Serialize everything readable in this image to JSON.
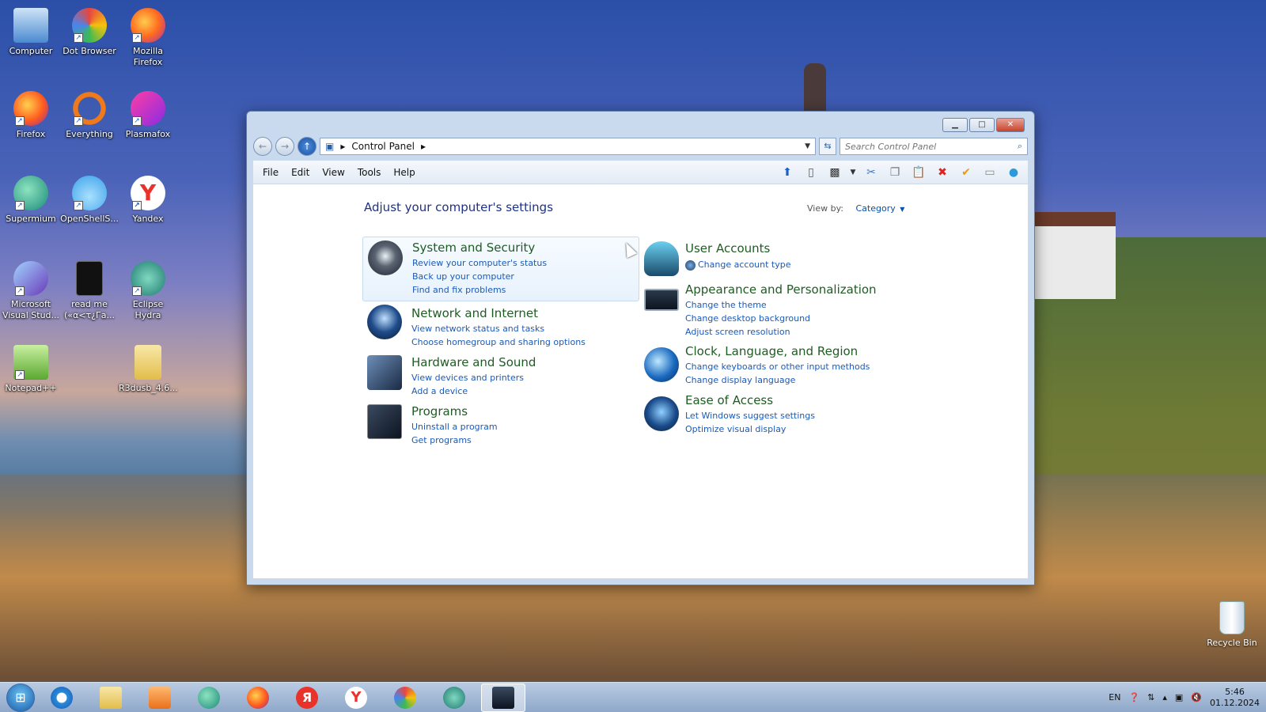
{
  "desktop": {
    "icons": [
      {
        "label": "Computer"
      },
      {
        "label": "Dot Browser"
      },
      {
        "label": "Mozilla Firefox"
      },
      {
        "label": "Firefox"
      },
      {
        "label": "Everything"
      },
      {
        "label": "Plasmafox"
      },
      {
        "label": "Supermium"
      },
      {
        "label": "OpenShellS..."
      },
      {
        "label": "Yandex"
      },
      {
        "label": "Microsoft Visual Stud..."
      },
      {
        "label": "read me («α<τ¿Гa..."
      },
      {
        "label": "Eclipse Hydra"
      },
      {
        "label": "Notepad++"
      },
      {
        "label": "R3dusb_4.6..."
      }
    ],
    "recycle_bin": "Recycle Bin"
  },
  "window": {
    "breadcrumb": "Control Panel",
    "search_placeholder": "Search Control Panel",
    "menu": [
      "File",
      "Edit",
      "View",
      "Tools",
      "Help"
    ],
    "heading": "Adjust your computer's settings",
    "view_by_label": "View by:",
    "view_by_value": "Category",
    "categories_left": [
      {
        "title": "System and Security",
        "links": [
          "Review your computer's status",
          "Back up your computer",
          "Find and fix problems"
        ]
      },
      {
        "title": "Network and Internet",
        "links": [
          "View network status and tasks",
          "Choose homegroup and sharing options"
        ]
      },
      {
        "title": "Hardware and Sound",
        "links": [
          "View devices and printers",
          "Add a device"
        ]
      },
      {
        "title": "Programs",
        "links": [
          "Uninstall a program",
          "Get programs"
        ]
      }
    ],
    "categories_right": [
      {
        "title": "User Accounts",
        "links": [
          "Change account type"
        ]
      },
      {
        "title": "Appearance and Personalization",
        "links": [
          "Change the theme",
          "Change desktop background",
          "Adjust screen resolution"
        ]
      },
      {
        "title": "Clock, Language, and Region",
        "links": [
          "Change keyboards or other input methods",
          "Change display language"
        ]
      },
      {
        "title": "Ease of Access",
        "links": [
          "Let Windows suggest settings",
          "Optimize visual display"
        ]
      }
    ]
  },
  "taskbar": {
    "lang": "EN",
    "time": "5:46",
    "date": "01.12.2024"
  }
}
